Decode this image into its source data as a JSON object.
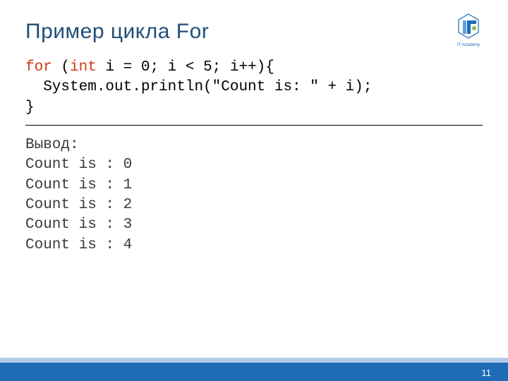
{
  "title": "Пример цикла For",
  "code": {
    "kw_for": "for",
    "after_for": " (",
    "kw_int": "int",
    "after_int": " i = 0; i < 5; i++){",
    "line2": "  System.out.println(\"Count is: \" + i);",
    "line3": "}"
  },
  "output": {
    "label": "Вывод:",
    "lines": [
      "Count is : 0",
      "Count is : 1",
      "Count is : 2",
      "Count is : 3",
      "Count is : 4"
    ]
  },
  "page_number": "11",
  "logo_caption": "IT-Academy",
  "colors": {
    "title": "#1f4e79",
    "keyword": "#d03a1a",
    "footer_light": "#b3cde8",
    "footer_dark": "#1f6bb5"
  }
}
